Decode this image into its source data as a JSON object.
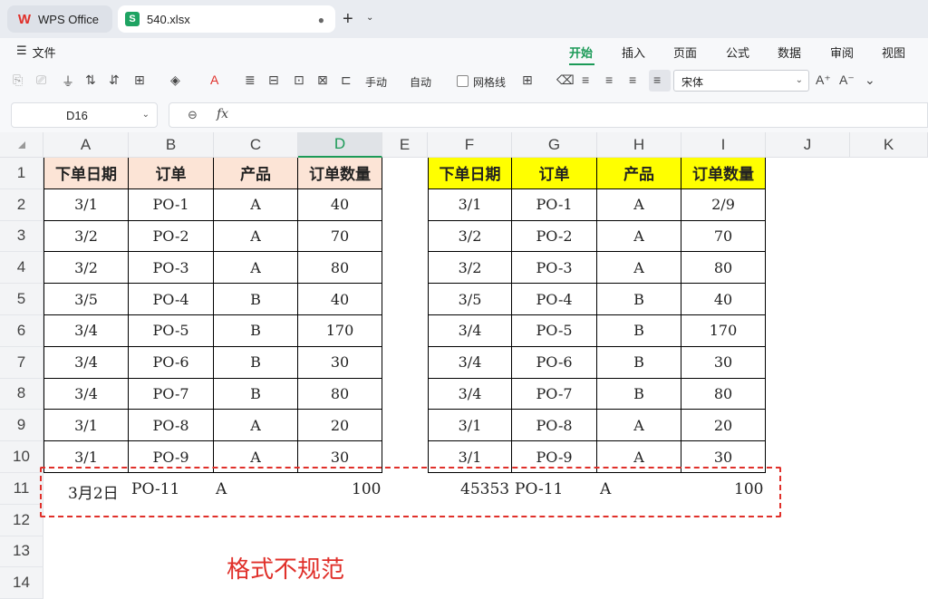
{
  "tabs": {
    "home": "WPS Office",
    "file": "540.xlsx",
    "new_tab": "+"
  },
  "menu": {
    "file": "文件",
    "ribbon_tabs": [
      "开始",
      "插入",
      "页面",
      "公式",
      "数据",
      "审阅",
      "视图"
    ],
    "active_tab": "开始"
  },
  "toolbar": {
    "manual": "手动",
    "auto": "自动",
    "gridlines": "网格线",
    "font_name": "宋体"
  },
  "formula_bar": {
    "cell_ref": "D16",
    "fx": "fx"
  },
  "columns": [
    "A",
    "B",
    "C",
    "D",
    "E",
    "F",
    "G",
    "H",
    "I",
    "J",
    "K"
  ],
  "selected_column": "D",
  "rows": [
    "1",
    "2",
    "3",
    "4",
    "5",
    "6",
    "7",
    "8",
    "9",
    "10",
    "11",
    "12",
    "13",
    "14"
  ],
  "left_table": {
    "header_color": "#fce4d6",
    "headers": [
      "下单日期",
      "订单",
      "产品",
      "订单数量"
    ],
    "rows": [
      [
        "3/1",
        "PO-1",
        "A",
        "40"
      ],
      [
        "3/2",
        "PO-2",
        "A",
        "70"
      ],
      [
        "3/2",
        "PO-3",
        "A",
        "80"
      ],
      [
        "3/5",
        "PO-4",
        "B",
        "40"
      ],
      [
        "3/4",
        "PO-5",
        "B",
        "170"
      ],
      [
        "3/4",
        "PO-6",
        "B",
        "30"
      ],
      [
        "3/4",
        "PO-7",
        "B",
        "80"
      ],
      [
        "3/1",
        "PO-8",
        "A",
        "20"
      ],
      [
        "3/1",
        "PO-9",
        "A",
        "30"
      ]
    ],
    "extra_row": [
      "3月2日",
      "PO-11",
      "A",
      "100"
    ]
  },
  "right_table": {
    "header_color": "#ffff00",
    "headers": [
      "下单日期",
      "订单",
      "产品",
      "订单数量"
    ],
    "rows": [
      [
        "3/1",
        "PO-1",
        "A",
        "2/9"
      ],
      [
        "3/2",
        "PO-2",
        "A",
        "70"
      ],
      [
        "3/2",
        "PO-3",
        "A",
        "80"
      ],
      [
        "3/5",
        "PO-4",
        "B",
        "40"
      ],
      [
        "3/4",
        "PO-5",
        "B",
        "170"
      ],
      [
        "3/4",
        "PO-6",
        "B",
        "30"
      ],
      [
        "3/4",
        "PO-7",
        "B",
        "80"
      ],
      [
        "3/1",
        "PO-8",
        "A",
        "20"
      ],
      [
        "3/1",
        "PO-9",
        "A",
        "30"
      ]
    ],
    "extra_row": [
      "45353",
      "PO-11",
      "A",
      "100"
    ]
  },
  "note": "格式不规范",
  "accent_color": "#1b9a57",
  "warning_color": "#e0302a"
}
